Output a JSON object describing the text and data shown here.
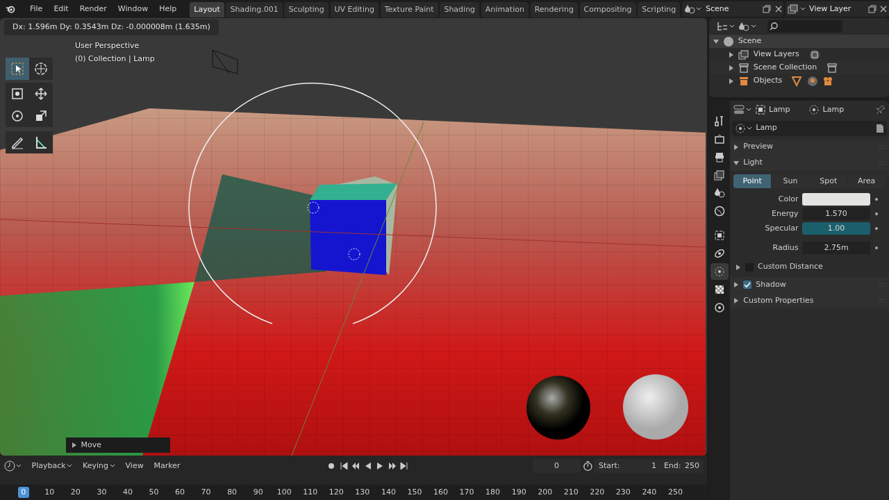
{
  "menu": [
    "File",
    "Edit",
    "Render",
    "Window",
    "Help"
  ],
  "workspaces": [
    {
      "label": "Layout",
      "selected": true
    },
    {
      "label": "Shading.001",
      "selected": false
    },
    {
      "label": "Sculpting",
      "selected": false
    },
    {
      "label": "UV Editing",
      "selected": false
    },
    {
      "label": "Texture Paint",
      "selected": false
    },
    {
      "label": "Shading",
      "selected": false
    },
    {
      "label": "Animation",
      "selected": false
    },
    {
      "label": "Rendering",
      "selected": false
    },
    {
      "label": "Compositing",
      "selected": false
    },
    {
      "label": "Scripting",
      "selected": false
    }
  ],
  "scene_selector": {
    "value": "Scene"
  },
  "view_layer_selector": {
    "value": "View Layer"
  },
  "viewport": {
    "header_text": "Dx: 1.596m  Dy: 0.3543m  Dz: -0.000008m (1.635m)",
    "overlay_lines": [
      "User Perspective",
      "(0) Collection | Lamp"
    ],
    "tools": [
      {
        "kind": "select",
        "selected": true
      },
      {
        "kind": "cursor",
        "selected": false
      },
      {
        "kind": "transform",
        "selected": false
      },
      {
        "kind": "move",
        "selected": false
      },
      {
        "kind": "rotate",
        "selected": false
      },
      {
        "kind": "scale",
        "selected": false
      },
      {
        "kind": "annotate",
        "selected": false
      },
      {
        "kind": "measure",
        "selected": false
      }
    ],
    "operator_panel": {
      "label": "Move",
      "expanded": false
    }
  },
  "outliner": {
    "items": [
      {
        "label": "Scene",
        "kind": "scene",
        "expanded": true,
        "children": [
          {
            "label": "View Layers",
            "kind": "view_layers",
            "expanded": false
          },
          {
            "label": "Scene Collection",
            "kind": "collection",
            "expanded": false
          },
          {
            "label": "Objects",
            "kind": "objects",
            "expanded": false
          }
        ]
      }
    ]
  },
  "properties": {
    "breadcrumb": [
      "Lamp",
      "Lamp"
    ],
    "datablock": "Lamp",
    "tabs": [
      {
        "kind": "tool",
        "selected": false
      },
      {
        "kind": "render",
        "selected": false
      },
      {
        "kind": "output",
        "selected": false
      },
      {
        "kind": "view_layer",
        "selected": false
      },
      {
        "kind": "scene",
        "selected": false
      },
      {
        "kind": "world",
        "selected": false
      },
      {
        "kind": "object",
        "selected": false
      },
      {
        "kind": "physics",
        "selected": false
      },
      {
        "kind": "light",
        "selected": true
      },
      {
        "kind": "texture",
        "selected": false
      },
      {
        "kind": "constraint",
        "selected": false
      }
    ],
    "panels": [
      {
        "title": "Preview",
        "expanded": false
      },
      {
        "title": "Light",
        "expanded": true,
        "light_types": [
          {
            "label": "Point",
            "selected": true
          },
          {
            "label": "Sun",
            "selected": false
          },
          {
            "label": "Spot",
            "selected": false
          },
          {
            "label": "Area",
            "selected": false
          }
        ],
        "fields": [
          {
            "kind": "color",
            "label": "Color"
          },
          {
            "kind": "number",
            "label": "Energy",
            "value": "1.570"
          },
          {
            "kind": "slider",
            "label": "Specular",
            "value": "1.00",
            "level": 1.0
          },
          {
            "kind": "number",
            "label": "Radius",
            "value": "2.75m"
          }
        ],
        "subpanels": [
          {
            "title": "Custom Distance",
            "expanded": false,
            "checked": false
          }
        ]
      },
      {
        "title": "Shadow",
        "expanded": false,
        "checked": true
      },
      {
        "title": "Custom Properties",
        "expanded": false
      }
    ]
  },
  "timeline": {
    "menus": [
      {
        "label": "Playback",
        "dropdown": true
      },
      {
        "label": "Keying",
        "dropdown": true
      },
      {
        "label": "View",
        "dropdown": false
      },
      {
        "label": "Marker",
        "dropdown": false
      }
    ],
    "current_frame": "0",
    "start_label": "Start:",
    "start": "1",
    "end_label": "End:",
    "end": "250",
    "ruler": [
      "0",
      "10",
      "20",
      "30",
      "40",
      "50",
      "60",
      "70",
      "80",
      "90",
      "100",
      "110",
      "120",
      "130",
      "140",
      "150",
      "160",
      "170",
      "180",
      "190",
      "200",
      "210",
      "220",
      "230",
      "240",
      "250"
    ]
  }
}
